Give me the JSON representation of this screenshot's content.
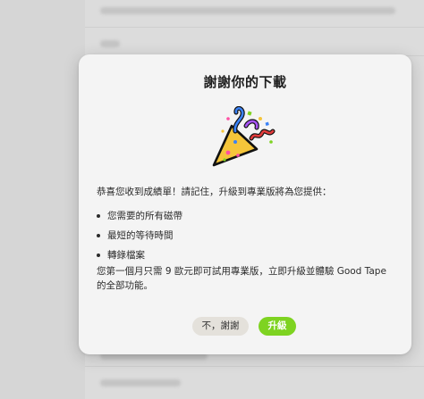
{
  "dialog": {
    "title": "謝謝你的下載",
    "intro": "恭喜您收到成績單！請記住，升級到專業版將為您提供：",
    "features": [
      "您需要的所有磁帶",
      "最短的等待時間",
      "轉錄檔案"
    ],
    "outro": "您第一個月只需 9 歐元即可試用專業版，立即升級並體驗 Good Tape 的全部功能。",
    "decline_label": "不，謝謝",
    "upgrade_label": "升級"
  },
  "colors": {
    "accent": "#7ed321",
    "decline_bg": "#e4e1db",
    "modal_bg": "#f4f4f4",
    "backdrop": "#dcdcdc"
  },
  "icons": {
    "illustration": "party-popper-icon"
  }
}
